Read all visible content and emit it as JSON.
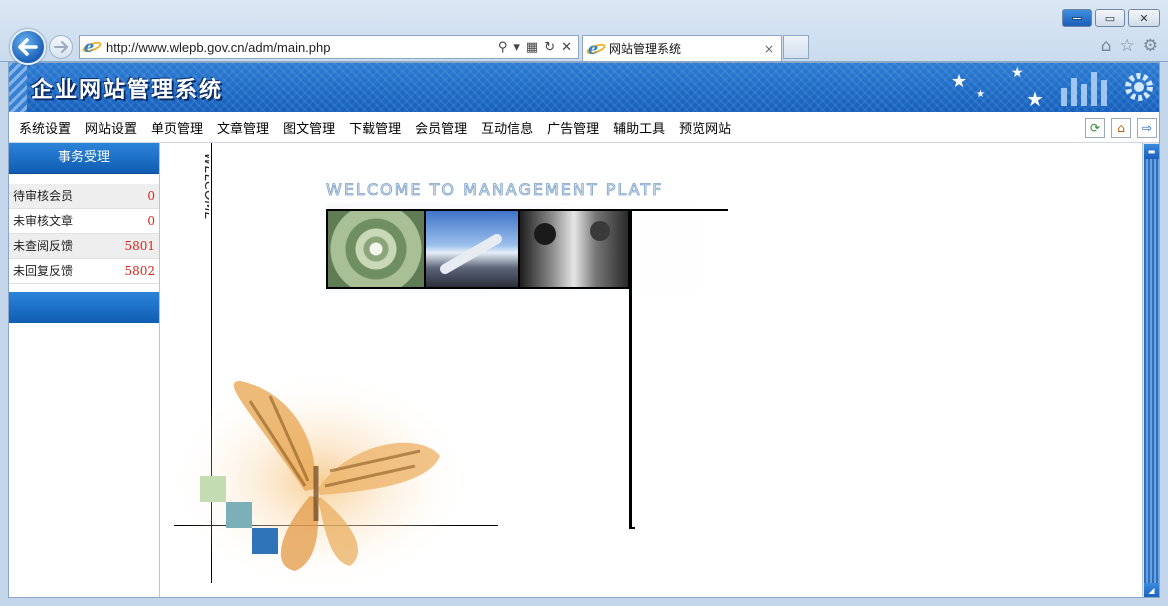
{
  "browser": {
    "url": "http://www.wlepb.gov.cn/adm/main.php",
    "tab_title": "网站管理系统",
    "tab_close": "×",
    "window_buttons": {
      "minimize": "",
      "restore": "▭",
      "close": "✕"
    },
    "address_tools": {
      "search": "⚲",
      "dropdown": "▾",
      "compat": "▦",
      "refresh": "↻",
      "stop": "✕"
    },
    "right_icons": {
      "home": "⌂",
      "favorites": "☆",
      "settings": "⚙"
    }
  },
  "site": {
    "title": "企业网站管理系统"
  },
  "menu": {
    "items": [
      "系统设置",
      "网站设置",
      "单页管理",
      "文章管理",
      "图文管理",
      "下载管理",
      "会员管理",
      "互动信息",
      "广告管理",
      "辅助工具",
      "预览网站"
    ],
    "icons": {
      "refresh": "⟳",
      "home": "⌂",
      "logout": "⇨"
    }
  },
  "sidebar": {
    "heading": "事务受理",
    "rows": [
      {
        "label": "待审核会员",
        "count": "0"
      },
      {
        "label": "未审核文章",
        "count": "0"
      },
      {
        "label": "未查阅反馈",
        "count": "5801"
      },
      {
        "label": "未回复反馈",
        "count": "5802"
      }
    ]
  },
  "welcome": {
    "vertical_text": "WELCOME",
    "banner_text": "WELCOME TO MANAGEMENT PLATF"
  },
  "colors": {
    "brand_blue": "#1560bd",
    "count_red": "#e0241b"
  }
}
